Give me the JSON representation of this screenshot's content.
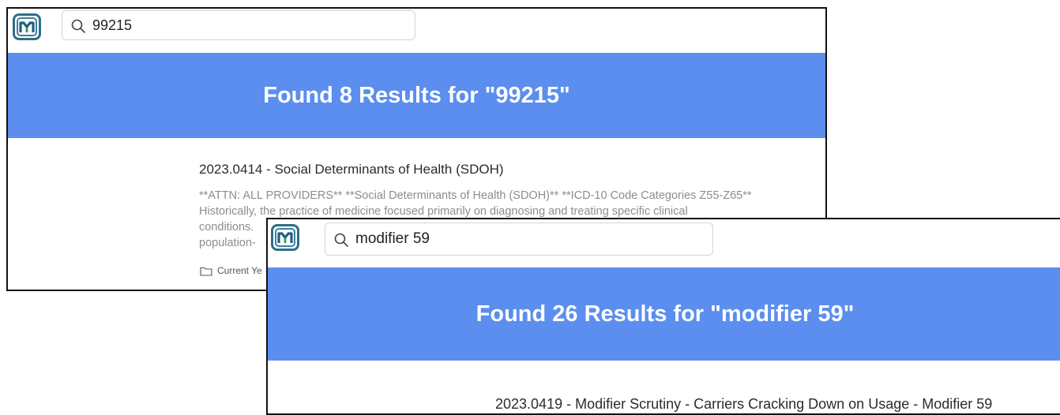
{
  "screenshot1": {
    "search": {
      "value": "99215"
    },
    "banner": "Found 8 Results for \"99215\"",
    "result": {
      "title": "2023.0414 - Social Determinants of Health (SDOH)",
      "snippet_line1": "**ATTN: ALL PROVIDERS** **Social Determinants of Health (SDOH)** **ICD-10 Code Categories Z55-Z65**",
      "snippet_line2": "Historically, the practice of medicine focused primarily on diagnosing and treating specific clinical",
      "snippet_line3": "conditions.",
      "snippet_line4": "population-",
      "tag": "Current Ye"
    }
  },
  "screenshot2": {
    "search": {
      "value": "modifier 59"
    },
    "banner": "Found 26 Results for \"modifier 59\"",
    "result": {
      "title": "2023.0419 - Modifier Scrutiny - Carriers Cracking Down on Usage - Modifier 59"
    }
  },
  "icons": {
    "logo": "m-logo-icon",
    "search": "search-icon",
    "folder": "folder-icon"
  },
  "colors": {
    "banner": "#5b8eee",
    "logo_border": "#2e6f86",
    "logo_m": "#1f5f86",
    "logo_accent": "#3a9a5a"
  }
}
